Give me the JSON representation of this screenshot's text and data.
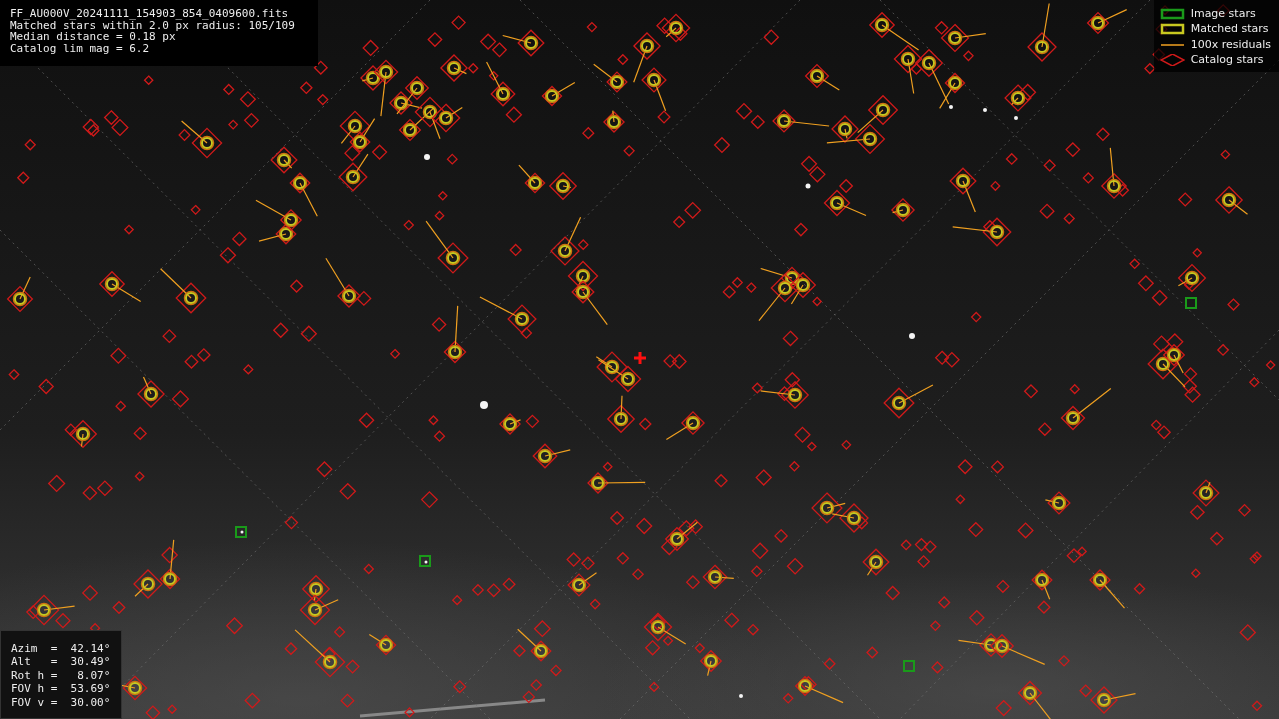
{
  "info_panel": {
    "lines": [
      "FF_AU000V_20241111_154903_854_0409600.fits",
      "Matched stars within 2.0 px radius: 105/109",
      "Median distance = 0.18 px",
      "Catalog lim mag = 6.2"
    ]
  },
  "legend": [
    {
      "label": "Image stars"
    },
    {
      "kind": "matched",
      "label": "Matched stars"
    },
    {
      "kind": "residual",
      "label": "100x residuals"
    },
    {
      "kind": "catalog",
      "label": "Catalog stars"
    }
  ],
  "pointing_panel": {
    "lines": [
      "Azim  =  42.14°",
      "Alt   =  30.49°",
      "Rot h =   8.07°",
      "FOV h =  53.69°",
      "FOV v =  30.00°"
    ]
  }
}
